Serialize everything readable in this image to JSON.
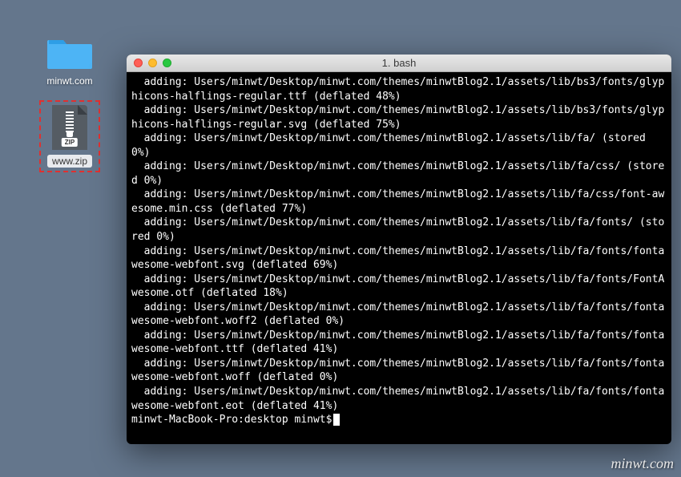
{
  "desktop": {
    "folder": {
      "label": "minwt.com"
    },
    "zip": {
      "label": "www.zip",
      "badge": "ZIP"
    }
  },
  "terminal": {
    "title": "1. bash",
    "lines": [
      "  adding: Users/minwt/Desktop/minwt.com/themes/minwtBlog2.1/assets/lib/bs3/fonts/glyphicons-halflings-regular.ttf (deflated 48%)",
      "  adding: Users/minwt/Desktop/minwt.com/themes/minwtBlog2.1/assets/lib/bs3/fonts/glyphicons-halflings-regular.svg (deflated 75%)",
      "  adding: Users/minwt/Desktop/minwt.com/themes/minwtBlog2.1/assets/lib/fa/ (stored 0%)",
      "  adding: Users/minwt/Desktop/minwt.com/themes/minwtBlog2.1/assets/lib/fa/css/ (stored 0%)",
      "  adding: Users/minwt/Desktop/minwt.com/themes/minwtBlog2.1/assets/lib/fa/css/font-awesome.min.css (deflated 77%)",
      "  adding: Users/minwt/Desktop/minwt.com/themes/minwtBlog2.1/assets/lib/fa/fonts/ (stored 0%)",
      "  adding: Users/minwt/Desktop/minwt.com/themes/minwtBlog2.1/assets/lib/fa/fonts/fontawesome-webfont.svg (deflated 69%)",
      "  adding: Users/minwt/Desktop/minwt.com/themes/minwtBlog2.1/assets/lib/fa/fonts/FontAwesome.otf (deflated 18%)",
      "  adding: Users/minwt/Desktop/minwt.com/themes/minwtBlog2.1/assets/lib/fa/fonts/fontawesome-webfont.woff2 (deflated 0%)",
      "  adding: Users/minwt/Desktop/minwt.com/themes/minwtBlog2.1/assets/lib/fa/fonts/fontawesome-webfont.ttf (deflated 41%)",
      "  adding: Users/minwt/Desktop/minwt.com/themes/minwtBlog2.1/assets/lib/fa/fonts/fontawesome-webfont.woff (deflated 0%)",
      "  adding: Users/minwt/Desktop/minwt.com/themes/minwtBlog2.1/assets/lib/fa/fonts/fontawesome-webfont.eot (deflated 41%)"
    ],
    "prompt": "minwt-MacBook-Pro:desktop minwt$ "
  },
  "watermark": "minwt.com"
}
